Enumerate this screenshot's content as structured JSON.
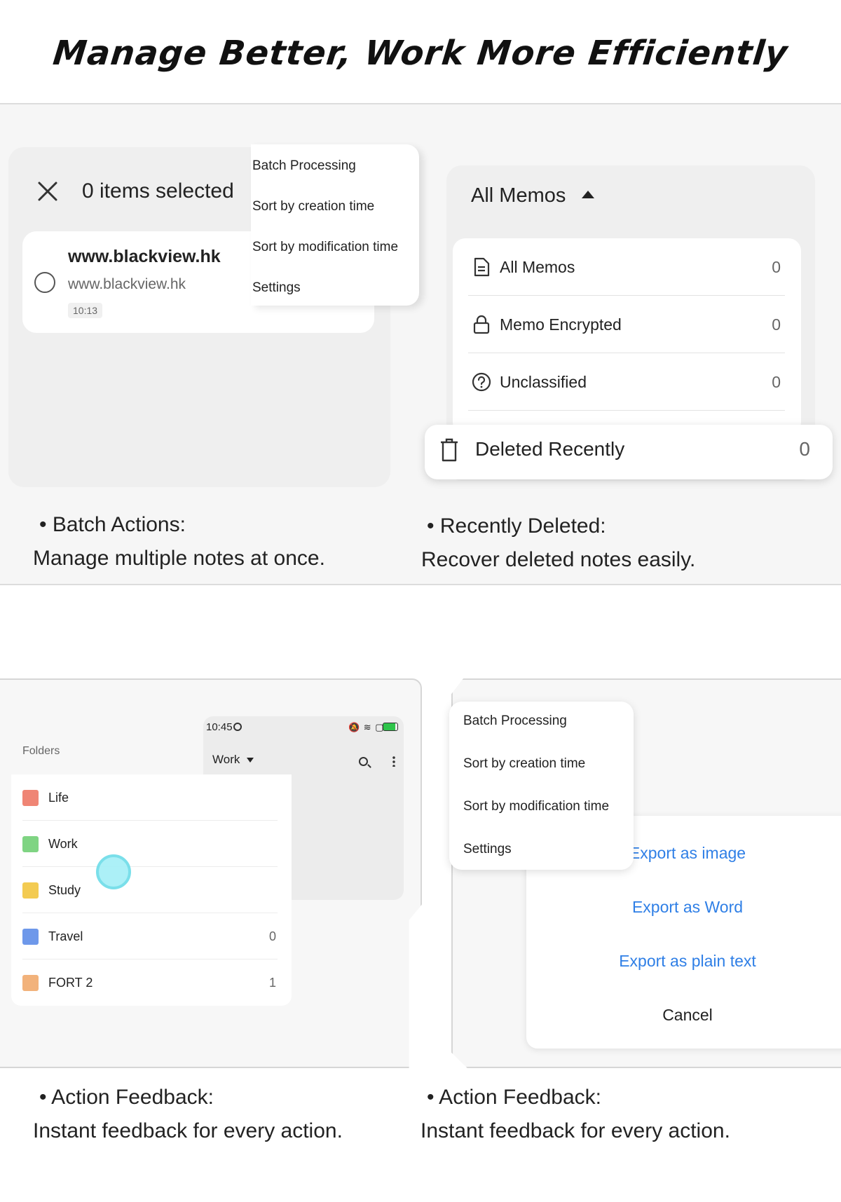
{
  "headline": "Manage Better, Work More Efficiently",
  "batch_panel": {
    "selected_text": "0 items selected",
    "note": {
      "title": "www.blackview.hk",
      "subtitle": "www.blackview.hk",
      "time": "10:13"
    },
    "menu": [
      "Batch Processing",
      "Sort by creation time",
      "Sort by modification time",
      "Settings"
    ]
  },
  "memos_panel": {
    "title": "All Memos",
    "rows": [
      {
        "label": "All Memos",
        "count": "0",
        "icon": "document-icon"
      },
      {
        "label": "Memo Encrypted",
        "count": "0",
        "icon": "lock-icon"
      },
      {
        "label": "Unclassified",
        "count": "0",
        "icon": "question-circle-icon"
      }
    ],
    "deleted": {
      "label": "Deleted Recently",
      "count": "0",
      "icon": "trash-icon"
    }
  },
  "captions": {
    "top_left": {
      "heading": "• Batch Actions:",
      "body": "Manage multiple notes at once."
    },
    "top_right": {
      "heading": "• Recently Deleted:",
      "body": "Recover deleted notes easily."
    },
    "bottom_left": {
      "heading": "• Action Feedback:",
      "body": "Instant feedback for every action."
    },
    "bottom_right": {
      "heading": "• Action Feedback:",
      "body": "Instant feedback for every action."
    }
  },
  "folders_panel": {
    "status_time": "10:45",
    "current_folder": "Work",
    "folders_label": "Folders",
    "folders": [
      {
        "label": "Life",
        "count": "",
        "color": "#ef8575"
      },
      {
        "label": "Work",
        "count": "",
        "color": "#7fd483"
      },
      {
        "label": "Study",
        "count": "",
        "color": "#f3cb52"
      },
      {
        "label": "Travel",
        "count": "0",
        "color": "#6e98ea"
      },
      {
        "label": "FORT 2",
        "count": "1",
        "color": "#f2b27b"
      }
    ]
  },
  "export_panel": {
    "menu": [
      "Batch Processing",
      "Sort by creation time",
      "Sort by modification time",
      "Settings"
    ],
    "options": [
      "Export as image",
      "Export as Word",
      "Export as plain text"
    ],
    "cancel": "Cancel"
  },
  "colors": {
    "accent_blue": "#2f7fe6",
    "touch_indicator": "#6fdde9"
  }
}
